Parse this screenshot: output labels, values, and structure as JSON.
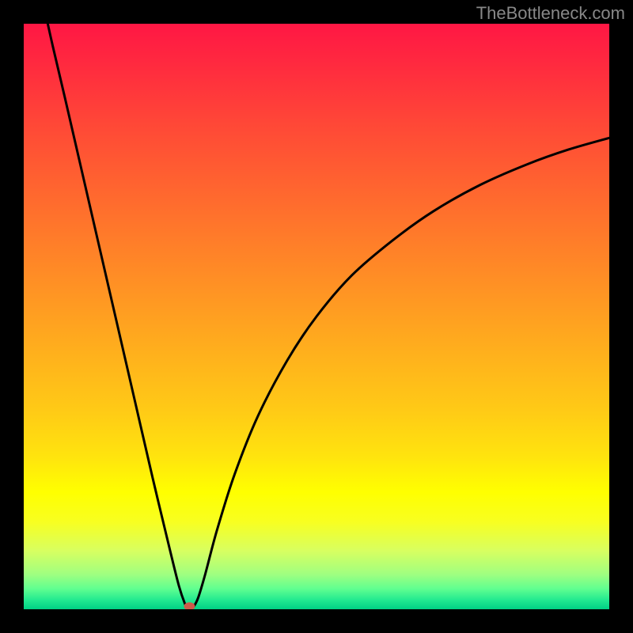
{
  "watermark": "TheBottleneck.com",
  "chart_data": {
    "type": "line",
    "title": "",
    "xlabel": "",
    "ylabel": "",
    "xlim": [
      0,
      100
    ],
    "ylim": [
      0,
      100
    ],
    "background_gradient_stops": [
      {
        "offset": 0.0,
        "color": "#ff1744"
      },
      {
        "offset": 0.07,
        "color": "#ff2a3f"
      },
      {
        "offset": 0.18,
        "color": "#ff4a36"
      },
      {
        "offset": 0.3,
        "color": "#ff6a2e"
      },
      {
        "offset": 0.42,
        "color": "#ff8a26"
      },
      {
        "offset": 0.54,
        "color": "#ffaa1e"
      },
      {
        "offset": 0.66,
        "color": "#ffca16"
      },
      {
        "offset": 0.74,
        "color": "#ffe40e"
      },
      {
        "offset": 0.8,
        "color": "#ffff00"
      },
      {
        "offset": 0.85,
        "color": "#f8ff20"
      },
      {
        "offset": 0.9,
        "color": "#d8ff60"
      },
      {
        "offset": 0.94,
        "color": "#a0ff80"
      },
      {
        "offset": 0.965,
        "color": "#60ff90"
      },
      {
        "offset": 0.985,
        "color": "#20e890"
      },
      {
        "offset": 1.0,
        "color": "#00d084"
      }
    ],
    "curve_points": [
      {
        "x": 4.1,
        "y": 100.0
      },
      {
        "x": 5.0,
        "y": 96.0
      },
      {
        "x": 7.0,
        "y": 87.5
      },
      {
        "x": 10.0,
        "y": 74.5
      },
      {
        "x": 13.0,
        "y": 61.5
      },
      {
        "x": 16.0,
        "y": 48.5
      },
      {
        "x": 19.0,
        "y": 35.5
      },
      {
        "x": 22.0,
        "y": 22.5
      },
      {
        "x": 25.0,
        "y": 10.0
      },
      {
        "x": 26.5,
        "y": 4.0
      },
      {
        "x": 27.5,
        "y": 1.0
      },
      {
        "x": 28.0,
        "y": 0.2
      },
      {
        "x": 28.5,
        "y": 0.0
      },
      {
        "x": 29.0,
        "y": 0.4
      },
      {
        "x": 29.8,
        "y": 2.0
      },
      {
        "x": 31.0,
        "y": 6.0
      },
      {
        "x": 33.0,
        "y": 13.5
      },
      {
        "x": 36.0,
        "y": 23.0
      },
      {
        "x": 40.0,
        "y": 33.0
      },
      {
        "x": 45.0,
        "y": 42.5
      },
      {
        "x": 50.0,
        "y": 50.0
      },
      {
        "x": 56.0,
        "y": 57.0
      },
      {
        "x": 63.0,
        "y": 63.0
      },
      {
        "x": 70.0,
        "y": 68.0
      },
      {
        "x": 78.0,
        "y": 72.5
      },
      {
        "x": 86.0,
        "y": 76.0
      },
      {
        "x": 93.0,
        "y": 78.5
      },
      {
        "x": 100.0,
        "y": 80.5
      }
    ],
    "marker": {
      "x": 28.3,
      "y": 0.5,
      "color": "#cc5a4a",
      "rx": 7,
      "ry": 5
    }
  }
}
